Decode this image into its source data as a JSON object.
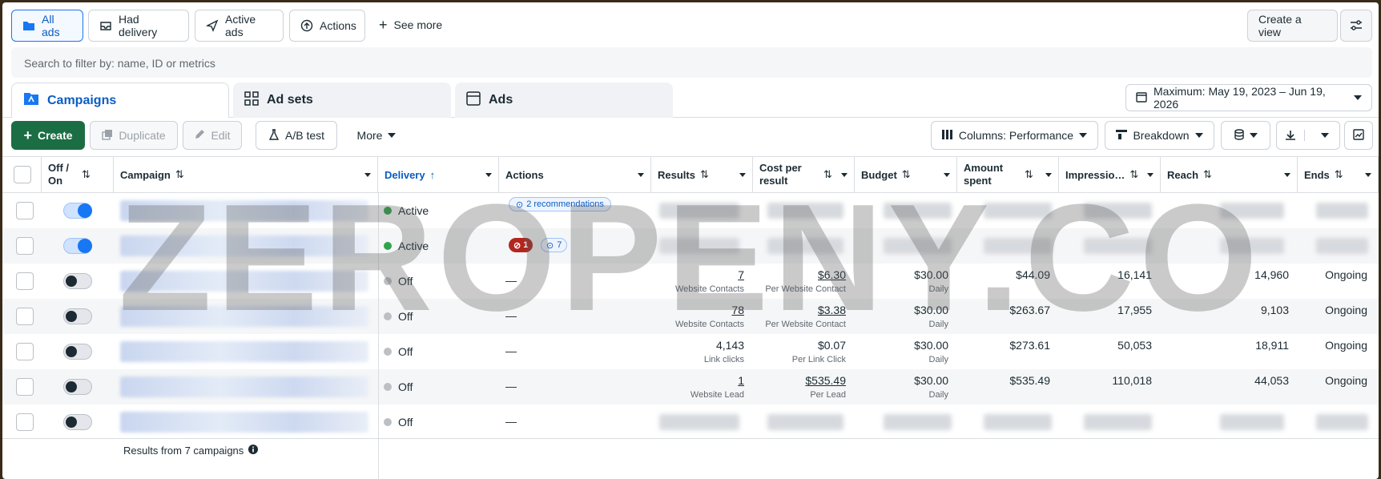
{
  "filters": {
    "chips": [
      {
        "label": "All ads",
        "icon": "folder-icon"
      },
      {
        "label": "Had delivery",
        "icon": "inbox-icon"
      },
      {
        "label": "Active ads",
        "icon": "send-icon"
      },
      {
        "label": "Actions",
        "icon": "arrow-up-circle-icon"
      }
    ],
    "see_more": "See more",
    "create_view": "Create a view"
  },
  "search": {
    "placeholder": "Search to filter by: name, ID or metrics"
  },
  "tabs": [
    {
      "label": "Campaigns",
      "selected": true
    },
    {
      "label": "Ad sets",
      "selected": false
    },
    {
      "label": "Ads",
      "selected": false
    }
  ],
  "date_range": "Maximum: May 19, 2023 – Jun 19, 2026",
  "toolbar": {
    "create": "Create",
    "duplicate": "Duplicate",
    "edit": "Edit",
    "ab_test": "A/B test",
    "more": "More",
    "columns": "Columns: Performance",
    "breakdown": "Breakdown"
  },
  "columns": {
    "off_on": "Off / On",
    "campaign": "Campaign",
    "delivery": "Delivery",
    "actions": "Actions",
    "results": "Results",
    "cost_per_result": "Cost per result",
    "budget": "Budget",
    "amount_spent": "Amount spent",
    "impressions": "Impressio…",
    "reach": "Reach",
    "ends": "Ends"
  },
  "rows": [
    {
      "on": true,
      "delivery": "Active",
      "delivery_color": "#31a24c",
      "actions": "2 recommendations",
      "results": "",
      "results_sub": "",
      "cpr": "",
      "cpr_sub": "",
      "budget": "",
      "budget_sub": "",
      "spent": "",
      "impr": "",
      "reach": "",
      "ends": ""
    },
    {
      "on": true,
      "delivery": "Active",
      "delivery_color": "#31a24c",
      "actions_badge": "1",
      "actions_rec": "7",
      "results": "",
      "results_sub": "",
      "cpr": "",
      "cpr_sub": "",
      "budget": "",
      "budget_sub": "",
      "spent": "",
      "impr": "",
      "reach": "",
      "ends": ""
    },
    {
      "on": false,
      "delivery": "Off",
      "delivery_color": "#bcc0c4",
      "actions": "—",
      "results": "7",
      "results_sub": "Website Contacts",
      "cpr": "$6.30",
      "cpr_sub": "Per Website Contact",
      "budget": "$30.00",
      "budget_sub": "Daily",
      "spent": "$44.09",
      "impr": "16,141",
      "reach": "14,960",
      "ends": "Ongoing"
    },
    {
      "on": false,
      "delivery": "Off",
      "delivery_color": "#bcc0c4",
      "actions": "—",
      "results": "78",
      "results_sub": "Website Contacts",
      "cpr": "$3.38",
      "cpr_sub": "Per Website Contact",
      "budget": "$30.00",
      "budget_sub": "Daily",
      "spent": "$263.67",
      "impr": "17,955",
      "reach": "9,103",
      "ends": "Ongoing"
    },
    {
      "on": false,
      "delivery": "Off",
      "delivery_color": "#bcc0c4",
      "actions": "—",
      "results": "4,143",
      "results_sub": "Link clicks",
      "cpr": "$0.07",
      "cpr_sub": "Per Link Click",
      "budget": "$30.00",
      "budget_sub": "Daily",
      "spent": "$273.61",
      "impr": "50,053",
      "reach": "18,911",
      "ends": "Ongoing"
    },
    {
      "on": false,
      "delivery": "Off",
      "delivery_color": "#bcc0c4",
      "actions": "—",
      "results": "1",
      "results_sub": "Website Lead",
      "cpr": "$535.49",
      "cpr_sub": "Per Lead",
      "budget": "$30.00",
      "budget_sub": "Daily",
      "spent": "$535.49",
      "impr": "110,018",
      "reach": "44,053",
      "ends": "Ongoing"
    },
    {
      "on": false,
      "delivery": "Off",
      "delivery_color": "#bcc0c4",
      "actions": "—",
      "results": "",
      "results_sub": "",
      "cpr": "",
      "cpr_sub": "",
      "budget": "",
      "budget_sub": "",
      "spent": "",
      "impr": "",
      "reach": "",
      "ends": ""
    }
  ],
  "footer": {
    "summary": "Results from 7 campaigns"
  },
  "watermark": "ZEROPENY.CO",
  "colors": {
    "accent": "#1877f2",
    "create_button": "#1b6e43",
    "active": "#31a24c",
    "error_badge": "#b3261e"
  }
}
